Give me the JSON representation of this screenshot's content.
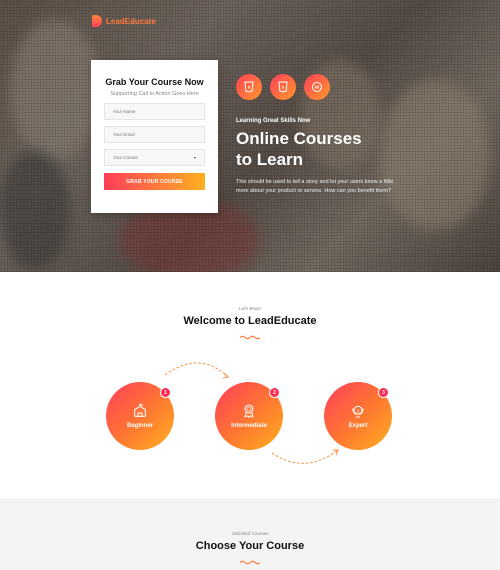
{
  "brand": {
    "name": "LeadEducate",
    "accent": "#ff7a3d",
    "gradient_start": "#ff3d5a",
    "gradient_end": "#ffb020"
  },
  "form": {
    "title": "Grab Your Course Now",
    "subtitle": "Supporting Call to Action Goes Here",
    "name_placeholder": "Your Name",
    "email_placeholder": "Your Email",
    "course_select": "Your Course",
    "submit_label": "GRAB YOUR COURSE"
  },
  "hero": {
    "tech_icons": [
      "html5-icon",
      "css3-icon",
      "wordpress-icon"
    ],
    "kicker": "Learning Great Skills Now",
    "headline_line1": "Online Courses",
    "headline_line2": "to Learn",
    "description": "This should be used to tell a story and let your users know a little more about your product or service. How can you benefit them?"
  },
  "welcome": {
    "pre": "Let's Begin",
    "title": "Welcome to LeadEducate",
    "steps": [
      {
        "num": "1",
        "label": "Beginner",
        "icon": "school-icon"
      },
      {
        "num": "2",
        "label": "Intermediate",
        "icon": "award-icon"
      },
      {
        "num": "3",
        "label": "Expert",
        "icon": "trophy-icon"
      }
    ]
  },
  "choose": {
    "pre": "Unlimited Courses",
    "title": "Choose Your Course"
  }
}
